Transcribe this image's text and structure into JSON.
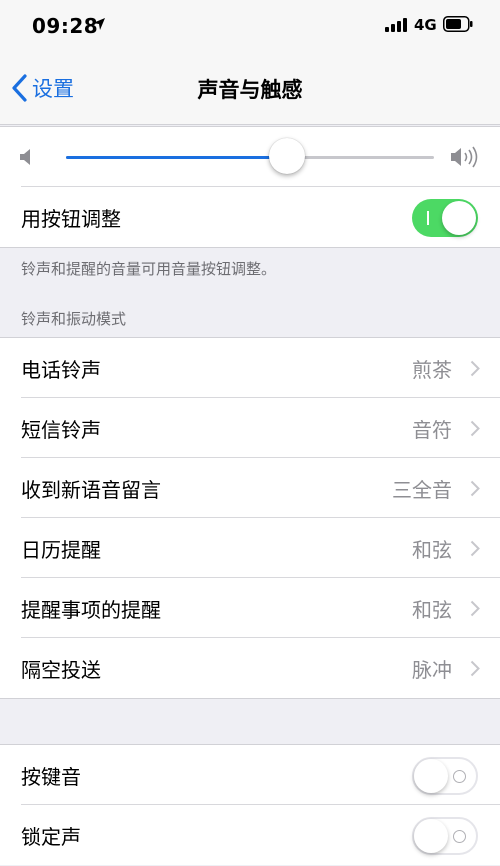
{
  "status_bar": {
    "time": "09:28",
    "network": "4G"
  },
  "nav": {
    "back_label": "设置",
    "title": "声音与触感"
  },
  "volume": {
    "level": 0.6
  },
  "use_buttons": {
    "label": "用按钮调整",
    "enabled": true
  },
  "note": "铃声和提醒的音量可用音量按钮调整。",
  "ringer_section": {
    "header": "铃声和振动模式",
    "items": [
      {
        "label": "电话铃声",
        "value": "煎茶"
      },
      {
        "label": "短信铃声",
        "value": "音符"
      },
      {
        "label": "收到新语音留言",
        "value": "三全音"
      },
      {
        "label": "日历提醒",
        "value": "和弦"
      },
      {
        "label": "提醒事项的提醒",
        "value": "和弦"
      },
      {
        "label": "隔空投送",
        "value": "脉冲"
      }
    ]
  },
  "toggles": [
    {
      "label": "按键音",
      "enabled": false
    },
    {
      "label": "锁定声",
      "enabled": false
    }
  ],
  "colors": {
    "accent": "#1a6fe0",
    "switch_on": "#4cd964",
    "background": "#efeff4"
  }
}
